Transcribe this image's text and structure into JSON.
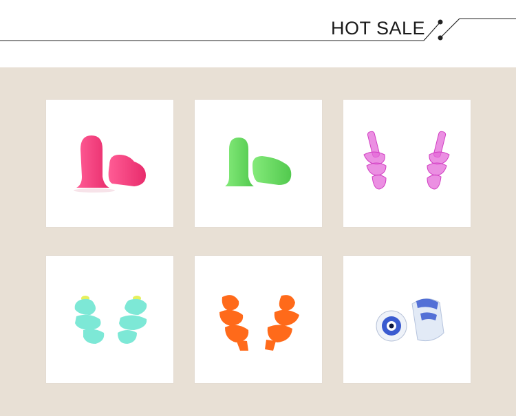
{
  "header": {
    "title": "HOT SALE",
    "line_color": "#222222"
  },
  "background_color": "#e8e0d5",
  "products": [
    {
      "name": "pink-foam-earplugs",
      "color": "#f2407c"
    },
    {
      "name": "green-foam-earplugs",
      "color": "#6fd968"
    },
    {
      "name": "magenta-silicone-earplugs",
      "color": "#e46ad8"
    },
    {
      "name": "mint-silicone-earplugs",
      "color": "#7de8d6"
    },
    {
      "name": "orange-silicone-earplugs",
      "color": "#ff6a1a"
    },
    {
      "name": "clear-blue-filter-earplugs",
      "color": "#3a5bd0"
    }
  ]
}
